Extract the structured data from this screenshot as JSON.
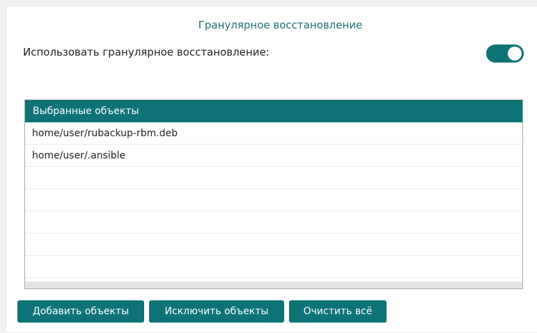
{
  "granular": {
    "title": "Гранулярное восстановление",
    "toggle_label": "Использовать гранулярное восстановление:",
    "toggle_on": true,
    "accent_color": "#0e7377"
  },
  "objects_table": {
    "header": "Выбранные объекты",
    "rows": [
      "home/user/rubackup-rbm.deb",
      "home/user/.ansible",
      "",
      "",
      "",
      "",
      ""
    ]
  },
  "buttons": {
    "add": "Добавить объекты",
    "exclude": "Исключить объекты",
    "clear": "Очистить всё"
  }
}
